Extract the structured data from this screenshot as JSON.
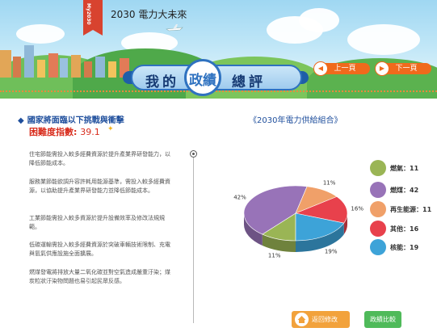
{
  "header": {
    "tag_text": "My2030",
    "title": "2030 電力大未來",
    "prev_label": "上一頁",
    "next_label": "下一頁",
    "heading_left": "我的",
    "heading_circle": "政績",
    "heading_right": "總評"
  },
  "left": {
    "section_title": "國家將面臨以下挑戰與衝擊",
    "difficulty_label": "困難度指數:",
    "difficulty_value": "39.1",
    "paragraphs": [
      "住宅節能需投入較多經費資源於提升產業界研發能力，以降低節能成本。",
      "服務業節能欲調升容許耗用能源基準，需投入較多經費資源，以協助提升產業界研發能力並降低節能成本。",
      "工業節能需投入較多資源於提升設備效率及修改法規規範。",
      "低碳運輸需投入較多經費資源於突破車輛技術限制、充電與氫氣供應設施全面擴展。",
      "燃煤發電將排放大量二氧化碳並對空氣造成嚴重汙染；煤炭粒狀汙染物問題也易引起民眾反感。"
    ]
  },
  "chart_data": {
    "type": "pie",
    "title": "《2030年電力供給組合》",
    "categories": [
      "燃氣",
      "燃煤",
      "再生能源",
      "其他",
      "核能"
    ],
    "values": [
      11,
      42,
      11,
      16,
      19
    ],
    "colors": [
      "#9ab555",
      "#9873b8",
      "#f0a069",
      "#e8414c",
      "#3da3d8"
    ],
    "slice_labels": [
      "11%",
      "42%",
      "11%",
      "16%",
      "19%"
    ],
    "legend": [
      {
        "label": "燃氣：11"
      },
      {
        "label": "燃煤：42"
      },
      {
        "label": "再生能源：11"
      },
      {
        "label": "其他：16"
      },
      {
        "label": "核能：19"
      }
    ]
  },
  "footer": {
    "back_label": "返回修改",
    "compare_label": "政績比較"
  },
  "colors": {
    "accent_orange": "#f06a1c",
    "heading_blue": "#1e4e9c",
    "difficulty_red": "#d82c1c"
  }
}
